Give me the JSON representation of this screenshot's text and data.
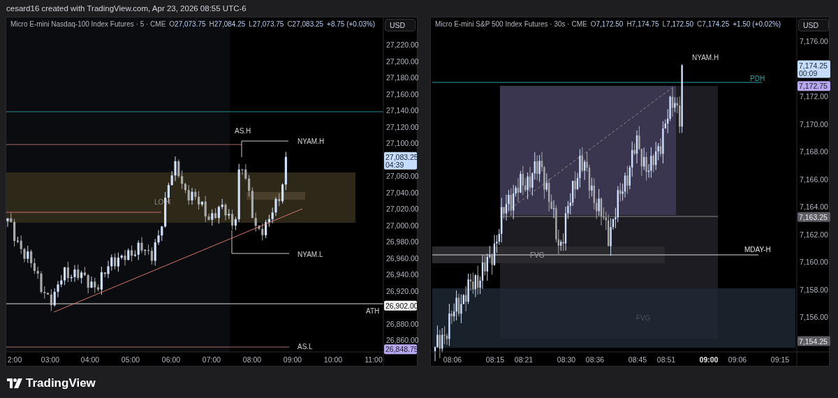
{
  "header": {
    "text": "cesard16 created with TradingView.com, Apr 23, 2026 08:55 UTC-6"
  },
  "charts": [
    {
      "legend": {
        "symbol": "Micro E-mini Nasdaq-100 Index Futures · 5 · CME",
        "ohlc": [
          {
            "label": "O",
            "value": "27,073.75"
          },
          {
            "label": "H",
            "value": "27,084.25"
          },
          {
            "label": "L",
            "value": "27,073.75"
          },
          {
            "label": "C",
            "value": "27,083.25"
          }
        ],
        "change": "+8.75 (+0.03%)"
      },
      "currency": "USD",
      "price_axis": [
        "27,220.00",
        "27,200.00",
        "27,180.00",
        "27,160.00",
        "27,140.00",
        "27,120.00",
        "27,100.00",
        "27,060.00",
        "27,040.00",
        "27,020.00",
        "27,000.00",
        "26,980.00",
        "26,960.00",
        "26,940.00",
        "26,920.00",
        "26,880.00",
        "26,860.00"
      ],
      "time_axis": [
        {
          "label": "2:00",
          "bold": false
        },
        {
          "label": "03:00",
          "bold": false
        },
        {
          "label": "04:00",
          "bold": false
        },
        {
          "label": "05:00",
          "bold": false
        },
        {
          "label": "06:00",
          "bold": false
        },
        {
          "label": "07:00",
          "bold": false
        },
        {
          "label": "08:00",
          "bold": false
        },
        {
          "label": "09:00",
          "bold": false
        },
        {
          "label": "10:00",
          "bold": false
        },
        {
          "label": "11:00",
          "bold": false
        }
      ],
      "price_tags": [
        {
          "kind": "last",
          "price": "27,083.25",
          "countdown": "04:39"
        },
        {
          "kind": "level",
          "price": "26,902.00"
        },
        {
          "kind": "alert",
          "price": "26,848.75"
        }
      ],
      "labels": [
        {
          "text": "AS.H",
          "color": "#d0d0d0"
        },
        {
          "text": "NYAM.H",
          "color": "#d0d0d0"
        },
        {
          "text": "LO.H",
          "color": "#8a8a8a"
        },
        {
          "text": "NYAM.L",
          "color": "#d0d0d0"
        },
        {
          "text": "ATH",
          "color": "#d0d0d0"
        },
        {
          "text": "AS.L",
          "color": "#d0d0d0"
        }
      ]
    },
    {
      "legend": {
        "symbol": "Micro E-mini S&P 500 Index Futures · 30s · CME",
        "ohlc": [
          {
            "label": "O",
            "value": "7,172.50"
          },
          {
            "label": "H",
            "value": "7,174.75"
          },
          {
            "label": "L",
            "value": "7,172.50"
          },
          {
            "label": "C",
            "value": "7,174.25"
          }
        ],
        "change": "+1.50 (+0.02%)"
      },
      "currency": "USD",
      "price_axis": [
        "7,176.00",
        "7,172.00",
        "7,170.00",
        "7,168.00",
        "7,166.00",
        "7,164.00",
        "7,162.00",
        "7,160.00",
        "7,158.00",
        "7,156.00"
      ],
      "time_axis": [
        {
          "label": "08:06",
          "bold": false
        },
        {
          "label": "08:15",
          "bold": false
        },
        {
          "label": "08:21",
          "bold": false
        },
        {
          "label": "08:30",
          "bold": false
        },
        {
          "label": "08:36",
          "bold": false
        },
        {
          "label": "08:45",
          "bold": false
        },
        {
          "label": "08:51",
          "bold": false
        },
        {
          "label": "09:00",
          "bold": true
        },
        {
          "label": "09:06",
          "bold": false
        },
        {
          "label": "09:15",
          "bold": false
        }
      ],
      "price_tags": [
        {
          "kind": "last",
          "price": "7,174.25",
          "countdown": "00:09"
        },
        {
          "kind": "alert",
          "price": "7,172.75"
        },
        {
          "kind": "marker",
          "price": "7,163.25"
        },
        {
          "kind": "marker",
          "price": "7,154.25"
        }
      ],
      "labels": [
        {
          "text": "NYAM.H",
          "color": "#d0d0d0"
        },
        {
          "text": "PDH",
          "color": "#2fa2a8"
        },
        {
          "text": "MDAY-H",
          "color": "#e0e0e0"
        },
        {
          "text": "FVG",
          "color": "#a0a4ab"
        },
        {
          "text": "FVG",
          "color": "#4a5058"
        }
      ]
    }
  ],
  "footer": {
    "brand": "TradingView"
  }
}
